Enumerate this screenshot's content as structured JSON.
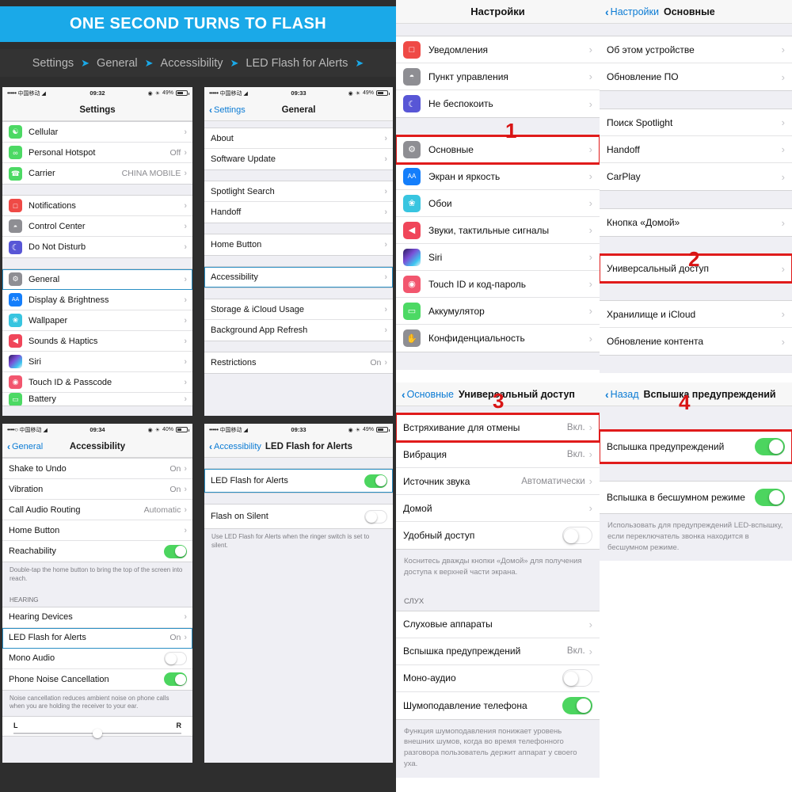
{
  "banner": {
    "title": "ONE SECOND TURNS TO FLASH"
  },
  "breadcrumb": {
    "items": [
      "Settings",
      "General",
      "Accessibility",
      "LED Flash for Alerts"
    ],
    "arrow": "➤"
  },
  "common": {
    "chevron": "›",
    "back_chevron": "‹",
    "carrier": "中国移动",
    "wifi_icon": "wifi-icon",
    "dots": "•••••",
    "dots_partial": "••••○"
  },
  "en_settings": {
    "status": {
      "time": "09:32",
      "battery": "49%"
    },
    "title": "Settings",
    "rows_group1": [
      {
        "label": "Cellular",
        "value": "",
        "icon": "cellular-icon",
        "icon_class": "ic-green",
        "glyph": "\u0001"
      },
      {
        "label": "Personal Hotspot",
        "value": "Off",
        "icon": "hotspot-icon",
        "icon_class": "ic-green",
        "glyph": "∞"
      },
      {
        "label": "Carrier",
        "value": "CHINA MOBILE",
        "icon": "carrier-icon",
        "icon_class": "ic-green",
        "glyph": "✆"
      }
    ],
    "rows_group2": [
      {
        "label": "Notifications",
        "value": "",
        "icon": "notifications-icon",
        "icon_class": "ic-red",
        "glyph": "▢"
      },
      {
        "label": "Control Center",
        "value": "",
        "icon": "control-center-icon",
        "icon_class": "ic-gray",
        "glyph": "⊙"
      },
      {
        "label": "Do Not Disturb",
        "value": "",
        "icon": "do-not-disturb-icon",
        "icon_class": "ic-purple",
        "glyph": "☾"
      }
    ],
    "rows_group3": [
      {
        "label": "General",
        "value": "",
        "icon": "gear-icon",
        "icon_class": "ic-gray",
        "glyph": "⚙",
        "highlight": true
      },
      {
        "label": "Display & Brightness",
        "value": "",
        "icon": "display-brightness-icon",
        "icon_class": "ic-blue",
        "glyph": "AA"
      },
      {
        "label": "Wallpaper",
        "value": "",
        "icon": "wallpaper-icon",
        "icon_class": "ic-cyan",
        "glyph": "❀"
      },
      {
        "label": "Sounds & Haptics",
        "value": "",
        "icon": "sounds-icon",
        "icon_class": "ic-pink",
        "glyph": "◀"
      },
      {
        "label": "Siri",
        "value": "",
        "icon": "siri-icon",
        "icon_class": "ic-siri",
        "glyph": ""
      },
      {
        "label": "Touch ID & Passcode",
        "value": "",
        "icon": "touch-id-icon",
        "icon_class": "ic-touch",
        "glyph": "◉"
      },
      {
        "label": "Battery",
        "value": "",
        "icon": "battery-icon",
        "icon_class": "ic-green",
        "glyph": "▭"
      }
    ]
  },
  "en_general": {
    "status": {
      "time": "09:33",
      "battery": "49%"
    },
    "back": "Settings",
    "title": "General",
    "group1": [
      {
        "label": "About",
        "value": ""
      },
      {
        "label": "Software Update",
        "value": ""
      }
    ],
    "group2": [
      {
        "label": "Spotlight Search",
        "value": ""
      },
      {
        "label": "Handoff",
        "value": ""
      }
    ],
    "group3": [
      {
        "label": "Home Button",
        "value": ""
      }
    ],
    "group4": [
      {
        "label": "Accessibility",
        "value": "",
        "highlight": true
      }
    ],
    "group5": [
      {
        "label": "Storage & iCloud Usage",
        "value": ""
      },
      {
        "label": "Background App Refresh",
        "value": ""
      }
    ],
    "group6": [
      {
        "label": "Restrictions",
        "value": "On"
      }
    ]
  },
  "en_accessibility": {
    "status": {
      "time": "09:34",
      "battery": "40%"
    },
    "back": "General",
    "title": "Accessibility",
    "group1": [
      {
        "label": "Shake to Undo",
        "value": "On",
        "kind": "chev"
      },
      {
        "label": "Vibration",
        "value": "On",
        "kind": "chev"
      },
      {
        "label": "Call Audio Routing",
        "value": "Automatic",
        "kind": "chev"
      },
      {
        "label": "Home Button",
        "value": "",
        "kind": "chev"
      },
      {
        "label": "Reachability",
        "value": "",
        "kind": "toggle",
        "toggle": "on"
      }
    ],
    "footnote1": "Double-tap the home button to bring the top of the screen into reach.",
    "section_hearing": "HEARING",
    "group2": [
      {
        "label": "Hearing Devices",
        "value": "",
        "kind": "chev"
      },
      {
        "label": "LED Flash for Alerts",
        "value": "On",
        "kind": "chev",
        "highlight": true
      },
      {
        "label": "Mono Audio",
        "value": "",
        "kind": "toggle",
        "toggle": "off"
      },
      {
        "label": "Phone Noise Cancellation",
        "value": "",
        "kind": "toggle",
        "toggle": "on"
      }
    ],
    "footnote2": "Noise cancellation reduces ambient noise on phone calls when you are holding the receiver to your ear.",
    "balance_left": "L",
    "balance_right": "R"
  },
  "en_led": {
    "status": {
      "time": "09:33",
      "battery": "49%"
    },
    "back": "Accessibility",
    "title": "LED Flash for Alerts",
    "group1": [
      {
        "label": "LED Flash for Alerts",
        "kind": "toggle",
        "toggle": "on",
        "highlight": true
      }
    ],
    "group2": [
      {
        "label": "Flash on Silent",
        "kind": "toggle",
        "toggle": "off"
      }
    ],
    "footnote": "Use LED Flash for Alerts when the ringer switch is set to silent."
  },
  "ru_settings": {
    "title": "Настройки",
    "step": "1",
    "group1": [
      {
        "label": "Уведомления",
        "icon": "notifications-icon",
        "icon_class": "ic-red",
        "glyph": "▢"
      },
      {
        "label": "Пункт управления",
        "icon": "control-center-icon",
        "icon_class": "ic-gray",
        "glyph": "⊙"
      },
      {
        "label": "Не беспокоить",
        "icon": "do-not-disturb-icon",
        "icon_class": "ic-purple",
        "glyph": "☾"
      }
    ],
    "group2": [
      {
        "label": "Основные",
        "icon": "gear-icon",
        "icon_class": "ic-gray",
        "glyph": "⚙",
        "redbox": true
      },
      {
        "label": "Экран и яркость",
        "icon": "display-brightness-icon",
        "icon_class": "ic-blue",
        "glyph": "AA"
      },
      {
        "label": "Обои",
        "icon": "wallpaper-icon",
        "icon_class": "ic-cyan",
        "glyph": "❀"
      },
      {
        "label": "Звуки, тактильные сигналы",
        "icon": "sounds-icon",
        "icon_class": "ic-pink",
        "glyph": "◀"
      },
      {
        "label": "Siri",
        "icon": "siri-icon",
        "icon_class": "ic-siri",
        "glyph": ""
      },
      {
        "label": "Touch ID и код-пароль",
        "icon": "touch-id-icon",
        "icon_class": "ic-touch",
        "glyph": "◉"
      },
      {
        "label": "Аккумулятор",
        "icon": "battery-icon",
        "icon_class": "ic-green",
        "glyph": "▭"
      },
      {
        "label": "Конфиденциальность",
        "icon": "privacy-icon",
        "icon_class": "ic-gray",
        "glyph": "✋"
      }
    ]
  },
  "ru_general": {
    "back": "Настройки",
    "title": "Основные",
    "step": "2",
    "group1": [
      {
        "label": "Об этом устройстве"
      },
      {
        "label": "Обновление ПО"
      }
    ],
    "group2": [
      {
        "label": "Поиск Spotlight"
      },
      {
        "label": "Handoff"
      },
      {
        "label": "CarPlay"
      }
    ],
    "group3": [
      {
        "label": "Кнопка «Домой»"
      }
    ],
    "group4": [
      {
        "label": "Универсальный доступ",
        "redbox": true
      }
    ],
    "group5": [
      {
        "label": "Хранилище и iCloud"
      },
      {
        "label": "Обновление контента"
      }
    ]
  },
  "ru_accessibility": {
    "back": "Основные",
    "title": "Универсальный доступ",
    "step": "3",
    "group1": [
      {
        "label": "Встряхивание для отмены",
        "value": "Вкл.",
        "kind": "chev",
        "redbox": true
      },
      {
        "label": "Вибрация",
        "value": "Вкл.",
        "kind": "chev"
      },
      {
        "label": "Источник звука",
        "value": "Автоматически",
        "kind": "chev"
      },
      {
        "label": "Домой",
        "value": "",
        "kind": "chev"
      },
      {
        "label": "Удобный доступ",
        "value": "",
        "kind": "toggle",
        "toggle": "off"
      }
    ],
    "footnote1": "Коснитесь дважды кнопки «Домой» для получения доступа к верхней части экрана.",
    "section_hearing": "СЛУХ",
    "group2": [
      {
        "label": "Слуховые аппараты",
        "value": "",
        "kind": "chev"
      },
      {
        "label": "Вспышка предупреждений",
        "value": "Вкл.",
        "kind": "chev"
      },
      {
        "label": "Моно-аудио",
        "value": "",
        "kind": "toggle",
        "toggle": "off"
      },
      {
        "label": "Шумоподавление телефона",
        "value": "",
        "kind": "toggle",
        "toggle": "on"
      }
    ],
    "footnote2": "Функция шумоподавления понижает уровень внешних шумов, когда во время телефонного разговора пользователь держит аппарат у своего уха."
  },
  "ru_led": {
    "back": "Назад",
    "title": "Вспышка предупреждений",
    "step": "4",
    "group1": [
      {
        "label": "Вспышка предупреждений",
        "kind": "toggle",
        "toggle": "on",
        "redbox": true
      }
    ],
    "group2": [
      {
        "label": "Вспышка в бесшумном режиме",
        "kind": "toggle",
        "toggle": "on"
      }
    ],
    "footnote": "Использовать для предупреждений LED-вспышку, если переключатель звонка находится в бесшумном режиме."
  },
  "colors": {
    "banner_bg": "#1aa9e8",
    "accent_blue": "#0b7bd4",
    "highlight_outline": "#2b8fc4",
    "redbox": "#e01b1b",
    "toggle_on": "#4cd55f"
  }
}
